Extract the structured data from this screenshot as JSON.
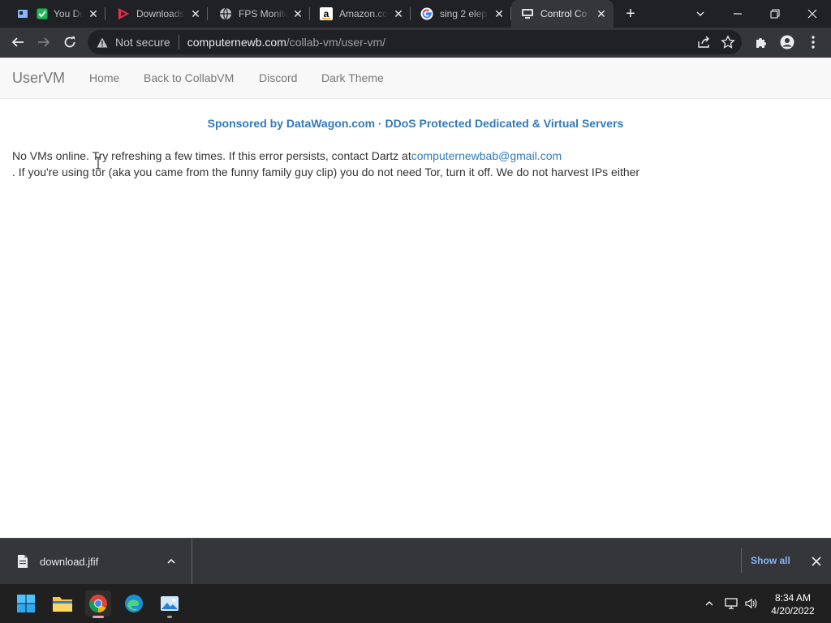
{
  "browser": {
    "tabs": [
      {
        "title": "You Do",
        "favicons": [
          "window-icon",
          "checkmark-icon"
        ],
        "active": false
      },
      {
        "title": "Downloads",
        "favicons": [
          "play-logo-icon"
        ],
        "active": false
      },
      {
        "title": "FPS Monito",
        "favicons": [
          "globe-icon"
        ],
        "active": false
      },
      {
        "title": "Amazon.co",
        "favicons": [
          "amazon-logo-icon"
        ],
        "active": false
      },
      {
        "title": "sing 2 elep",
        "favicons": [
          "google-logo-icon"
        ],
        "active": false
      },
      {
        "title": "Control Co",
        "favicons": [
          "computer-icon"
        ],
        "active": true
      }
    ],
    "omnibox": {
      "security_label": "Not secure",
      "url_host": "computernewb.com",
      "url_path": "/collab-vm/user-vm/"
    }
  },
  "page": {
    "navbar": {
      "brand": "UserVM",
      "links": [
        "Home",
        "Back to CollabVM",
        "Discord",
        "Dark Theme"
      ]
    },
    "sponsor": "Sponsored by DataWagon.com · DDoS Protected Dedicated & Virtual Servers",
    "message": {
      "line1_text": "No VMs online. Try refreshing a few times. If this error persists, contact Dartz at",
      "email": "computernewbab@gmail.com",
      "line2_text": ". If you're using tor (aka you came from the funny family guy clip) you do not need Tor, turn it off. We do not harvest IPs either"
    }
  },
  "download_bar": {
    "filename": "download.jfif",
    "show_all": "Show all"
  },
  "taskbar": {
    "apps": [
      "start-icon",
      "file-explorer-icon",
      "chrome-icon",
      "edge-icon",
      "photos-icon"
    ],
    "time": "8:34 AM",
    "date": "4/20/2022"
  },
  "colors": {
    "link": "#337ab7",
    "navbar_bg": "#f8f8f8",
    "tabstrip_bg": "#202124",
    "toolbar_bg": "#35363a",
    "show_all": "#8ab4f8"
  }
}
